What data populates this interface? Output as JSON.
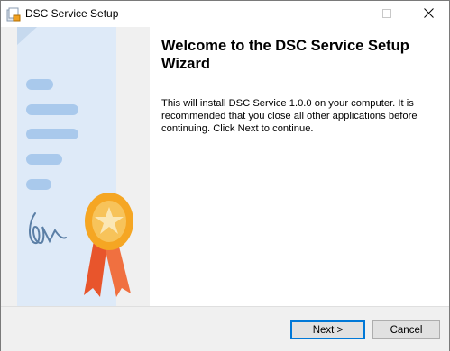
{
  "window": {
    "title": "DSC Service Setup",
    "icons": {
      "app": "setup-box-icon",
      "minimize": "minimize-icon",
      "maximize": "maximize-icon",
      "close": "close-icon"
    }
  },
  "side_panel": {
    "illustration": "certificate-with-award-ribbon"
  },
  "content": {
    "heading": "Welcome to the DSC Service Setup Wizard",
    "body": "This will install DSC Service 1.0.0 on your computer. It is recommended that you close all other applications before continuing. Click Next to continue."
  },
  "footer": {
    "next_label": "Next >",
    "cancel_label": "Cancel"
  },
  "colors": {
    "accent": "#0078d7",
    "panel_bg": "#f0f0f0",
    "document": "#deeaf7",
    "document_fold": "#c6d9ee",
    "text_lines": "#a8c8ec",
    "signature": "#5b7fa6",
    "medal": "#f5a623",
    "ribbon": "#ef6a3a"
  }
}
